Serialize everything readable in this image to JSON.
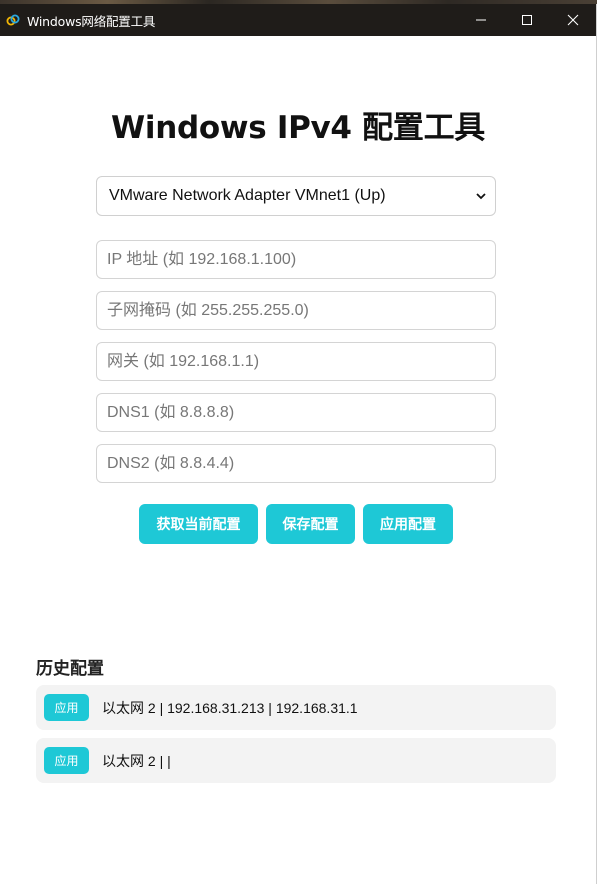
{
  "window": {
    "title": "Windows网络配置工具"
  },
  "page": {
    "title": "Windows IPv4 配置工具"
  },
  "adapter": {
    "selected": "VMware Network Adapter VMnet1 (Up)"
  },
  "fields": {
    "ip_placeholder": "IP 地址 (如 192.168.1.100)",
    "subnet_placeholder": "子网掩码 (如 255.255.255.0)",
    "gateway_placeholder": "网关 (如 192.168.1.1)",
    "dns1_placeholder": "DNS1 (如 8.8.8.8)",
    "dns2_placeholder": "DNS2 (如 8.8.4.4)"
  },
  "buttons": {
    "get_current": "获取当前配置",
    "save": "保存配置",
    "apply": "应用配置"
  },
  "history": {
    "title": "历史配置",
    "items": [
      {
        "apply_label": "应用",
        "text": "以太网 2 | 192.168.31.213 | 192.168.31.1"
      },
      {
        "apply_label": "应用",
        "text": "以太网 2 | |"
      }
    ]
  },
  "colors": {
    "accent": "#1ec8d6",
    "titlebar": "#1f1c19"
  }
}
